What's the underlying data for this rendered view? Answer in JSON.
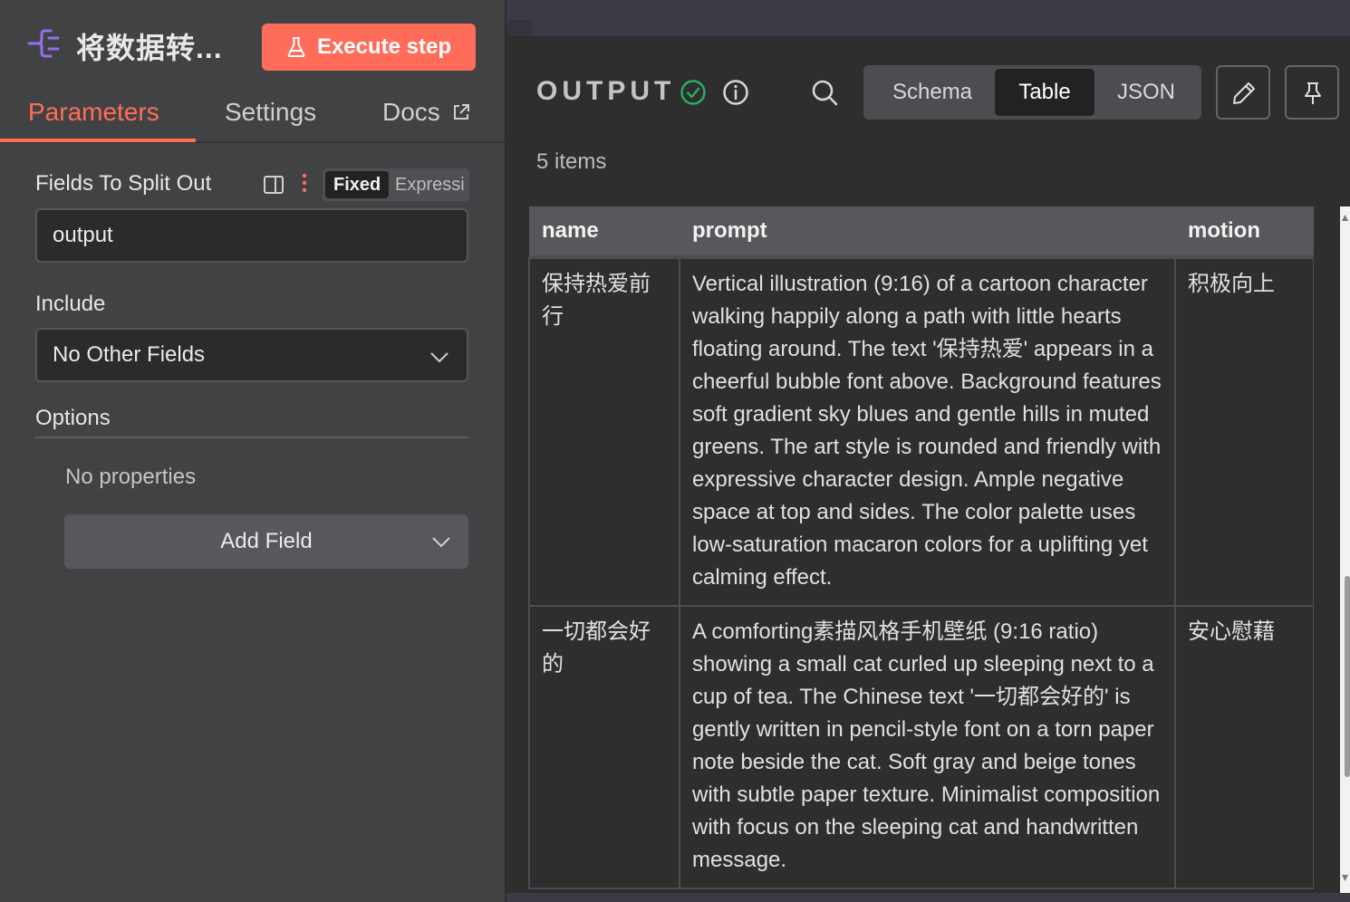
{
  "node": {
    "title": "将数据转...",
    "execute_label": "Execute step",
    "accent_color": "#ff6d5a"
  },
  "tabs": {
    "parameters": "Parameters",
    "settings": "Settings",
    "docs": "Docs"
  },
  "params": {
    "fields_label": "Fields To Split Out",
    "mode_fixed": "Fixed",
    "mode_expression": "Expressi",
    "fields_value": "output",
    "include_label": "Include",
    "include_value": "No Other Fields",
    "options_label": "Options",
    "no_properties": "No properties",
    "add_field_label": "Add Field"
  },
  "output": {
    "title": "OUTPUT",
    "views": [
      "Schema",
      "Table",
      "JSON"
    ],
    "selected_view": "Table",
    "items_count": "5 items",
    "status_color": "#27ae60",
    "columns": [
      "name",
      "prompt",
      "motion"
    ],
    "rows": [
      {
        "name": "保持热爱前行",
        "prompt": "Vertical illustration (9:16) of a cartoon character walking happily along a path with little hearts floating around. The text '保持热爱' appears in a cheerful bubble font above. Background features soft gradient sky blues and gentle hills in muted greens. The art style is rounded and friendly with expressive character design. Ample negative space at top and sides. The color palette uses low-saturation macaron colors for a uplifting yet calming effect.",
        "motion": "积极向上"
      },
      {
        "name": "一切都会好的",
        "prompt": "A comforting素描风格手机壁纸 (9:16 ratio) showing a small cat curled up sleeping next to a cup of tea. The Chinese text '一切都会好的' is gently written in pencil-style font on a torn paper note beside the cat. Soft gray and beige tones with subtle paper texture. Minimalist composition with focus on the sleeping cat and handwritten message.",
        "motion": "安心慰藉"
      }
    ]
  }
}
